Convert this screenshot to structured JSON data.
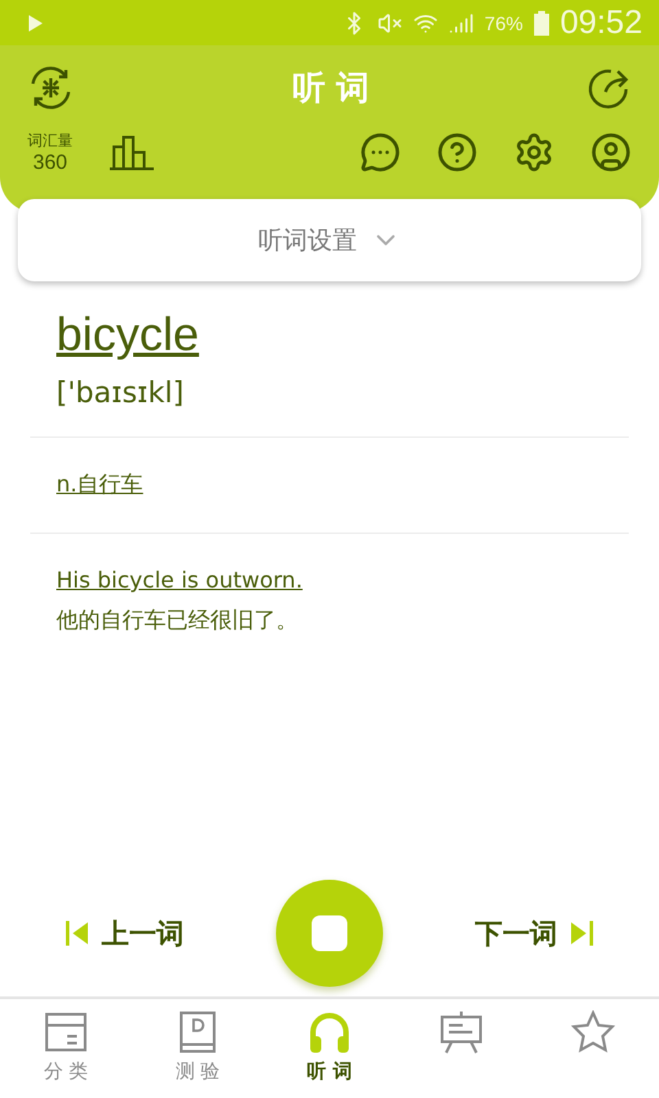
{
  "status_bar": {
    "battery": "76%",
    "time": "09:52"
  },
  "header": {
    "title": "听 词",
    "vocab_label": "词汇量",
    "vocab_count": "360"
  },
  "settings_dropdown": {
    "label": "听词设置"
  },
  "word": {
    "headword": "bicycle",
    "phonetic": "['baɪsɪkl]",
    "definition": "n.自行车",
    "example": "His bicycle is outworn.",
    "translation": "他的自行车已经很旧了。"
  },
  "controls": {
    "previous": "上一词",
    "next": "下一词"
  },
  "tabs": [
    {
      "kind": "box",
      "label": "分 类",
      "selected": false
    },
    {
      "kind": "book",
      "label": "测 验",
      "selected": false
    },
    {
      "kind": "headphones",
      "label": "听 词",
      "selected": true
    },
    {
      "kind": "board",
      "selected": false
    },
    {
      "kind": "star",
      "selected": false
    }
  ]
}
